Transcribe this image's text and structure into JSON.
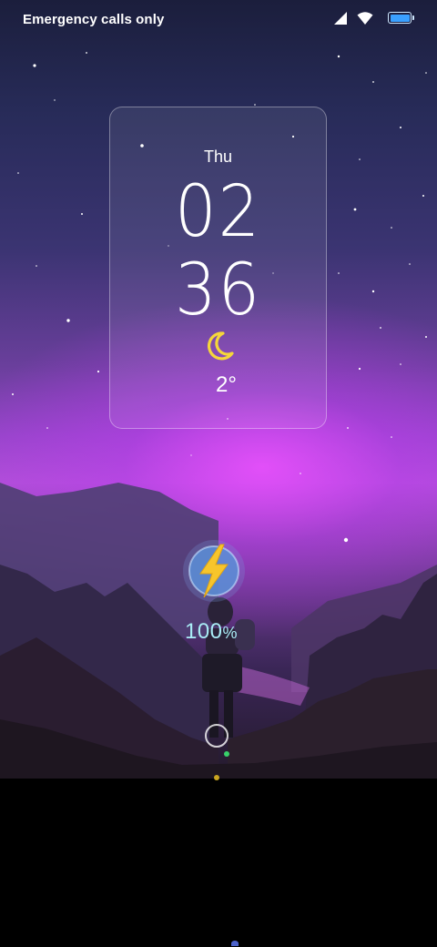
{
  "status_bar": {
    "carrier_text": "Emergency calls only",
    "icons": [
      "signal-icon",
      "wifi-icon",
      "battery-icon"
    ],
    "battery_level": 1.0,
    "battery_color": "#3aa0ff"
  },
  "clock": {
    "day": "Thu",
    "hour": "02",
    "minute": "36",
    "weather_icon": "moon-icon",
    "temperature": "2°"
  },
  "charging": {
    "icon": "lightning-bolt-icon",
    "percent_value": "100",
    "percent_sign": "%",
    "text_color": "#a9ecf6"
  },
  "unlock": {
    "icon": "unlock-ring-icon"
  },
  "colors": {
    "accent_purple": "#b04fd8",
    "moon": "#f5d63a",
    "bolt": "#f7c52b"
  }
}
